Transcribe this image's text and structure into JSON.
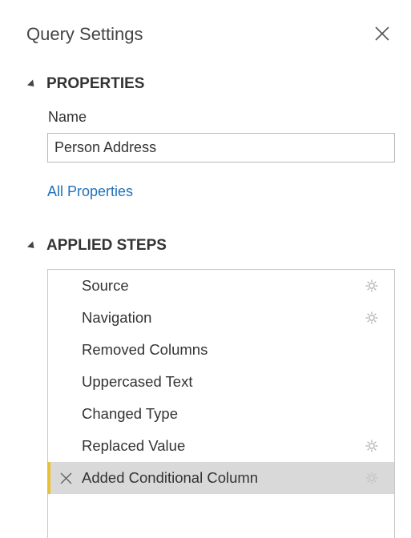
{
  "header": {
    "title": "Query Settings",
    "close_icon": "close-icon"
  },
  "properties": {
    "section_label": "PROPERTIES",
    "name_label": "Name",
    "name_value": "Person Address",
    "all_properties_link": "All Properties",
    "link_color": "#1f72ba"
  },
  "applied_steps": {
    "section_label": "APPLIED STEPS",
    "selected_accent_color": "#e8c22e",
    "selected_background": "#d9d9d9",
    "items": [
      {
        "label": "Source",
        "has_gear": true,
        "selected": false
      },
      {
        "label": "Navigation",
        "has_gear": true,
        "selected": false
      },
      {
        "label": "Removed Columns",
        "has_gear": false,
        "selected": false
      },
      {
        "label": "Uppercased Text",
        "has_gear": false,
        "selected": false
      },
      {
        "label": "Changed Type",
        "has_gear": false,
        "selected": false
      },
      {
        "label": "Replaced Value",
        "has_gear": true,
        "selected": false
      },
      {
        "label": "Added Conditional Column",
        "has_gear": true,
        "selected": true,
        "delete_icon": "delete-step-icon"
      }
    ]
  }
}
